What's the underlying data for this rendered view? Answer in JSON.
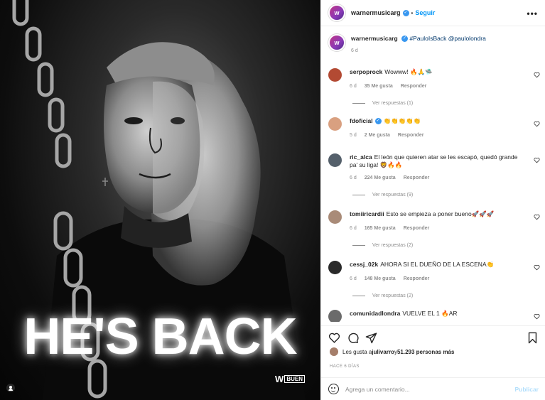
{
  "post": {
    "username": "warnermusicarg",
    "follow_label": "Seguir",
    "avatar_letter": "w",
    "more_label": "•••"
  },
  "image": {
    "headline": "HE'S BACK",
    "brand_w": "W",
    "brand_label": "BUEN"
  },
  "caption": {
    "username": "warnermusicarg",
    "text": "#PauloIsBack @paulolondra",
    "age": "6 d"
  },
  "comments": [
    {
      "username": "serpoprock",
      "text": "Wowww! 🔥🙏🛸",
      "age": "6 d",
      "likes": "35 Me gusta",
      "reply": "Responder",
      "replies": "Ver respuestas (1)",
      "color": "#b34a33"
    },
    {
      "username": "fdoficial",
      "verified": true,
      "text": "👏👏👏👏👏",
      "age": "5 d",
      "likes": "2 Me gusta",
      "reply": "Responder",
      "color": "#d9a080"
    },
    {
      "username": "ric_alca",
      "text": "El león que quieren atar se les escapó, quedó grande pa' su liga! 🦁🔥🔥",
      "age": "6 d",
      "likes": "224 Me gusta",
      "reply": "Responder",
      "replies": "Ver respuestas (9)",
      "color": "#55606b"
    },
    {
      "username": "tomiiricardii",
      "text": "Esto se empieza a poner bueno🚀🚀🚀",
      "age": "6 d",
      "likes": "165 Me gusta",
      "reply": "Responder",
      "replies": "Ver respuestas (2)",
      "color": "#a98b78"
    },
    {
      "username": "cessj_02k",
      "text": "AHORA SI EL DUEÑO DE LA ESCENA👏",
      "age": "6 d",
      "likes": "148 Me gusta",
      "reply": "Responder",
      "replies": "Ver respuestas (2)",
      "color": "#2a2a2a"
    },
    {
      "username": "comunidadlondra",
      "text": "VUELVE EL 1 🔥AR",
      "color": "#6b6b6b"
    }
  ],
  "likes_summary": {
    "prefix": "Les gusta a ",
    "user": "julivarro",
    "middle": " y ",
    "count": "51.293 personas más"
  },
  "time": "HACE 6 DÍAS",
  "add_comment": {
    "placeholder": "Agrega un comentario...",
    "post_label": "Publicar"
  },
  "colors": {
    "link_blue": "#0095f6",
    "verified_blue": "#3897f0",
    "muted": "#8e8e8e",
    "post_disabled": "#b2dffc"
  }
}
